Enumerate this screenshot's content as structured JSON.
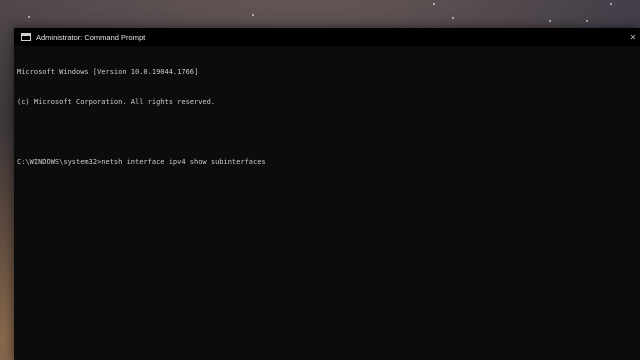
{
  "window": {
    "title": "Administrator: Command Prompt"
  },
  "console": {
    "lines": [
      "Microsoft Windows [Version 10.0.19044.1766]",
      "(c) Microsoft Corporation. All rights reserved.",
      "",
      "C:\\WINDOWS\\system32>netsh interface ipv4 show subinterfaces"
    ]
  },
  "colors": {
    "console_bg": "#0c0c0c",
    "console_text": "#cccccc",
    "titlebar_bg": "#000000"
  },
  "icons": {
    "title": "cmd-icon",
    "close": "close-icon"
  }
}
